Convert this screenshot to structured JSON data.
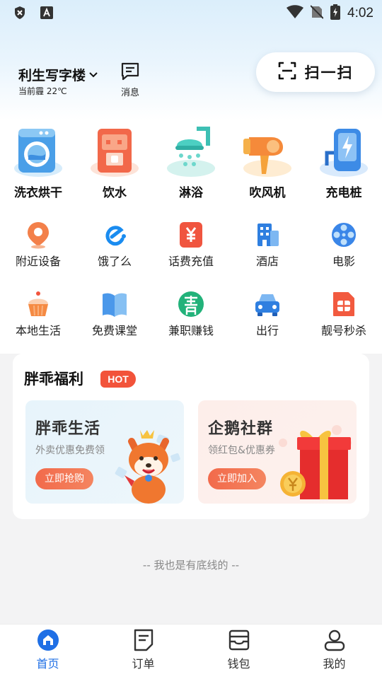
{
  "status_bar": {
    "time": "4:02",
    "icons": [
      "shield-x-icon",
      "a-icon",
      "wifi-icon",
      "no-sim-icon",
      "battery-charging-icon"
    ]
  },
  "header": {
    "location": "利生写字楼",
    "weather": "当前霾  22℃",
    "message_label": "消息",
    "scan_label": "扫一扫"
  },
  "services": [
    {
      "label": "洗衣烘干",
      "icon": "washing-machine-icon"
    },
    {
      "label": "饮水",
      "icon": "water-dispenser-icon"
    },
    {
      "label": "淋浴",
      "icon": "shower-icon"
    },
    {
      "label": "吹风机",
      "icon": "hair-dryer-icon"
    },
    {
      "label": "充电桩",
      "icon": "charging-pile-icon"
    }
  ],
  "grid_row1": [
    {
      "label": "附近设备",
      "icon": "location-pin-icon"
    },
    {
      "label": "饿了么",
      "icon": "eleme-icon"
    },
    {
      "label": "话费充值",
      "icon": "yen-icon"
    },
    {
      "label": "酒店",
      "icon": "hotel-icon"
    },
    {
      "label": "电影",
      "icon": "film-reel-icon"
    }
  ],
  "grid_row2": [
    {
      "label": "本地生活",
      "icon": "cupcake-icon"
    },
    {
      "label": "免费课堂",
      "icon": "book-icon"
    },
    {
      "label": "兼职赚钱",
      "icon": "qing-icon"
    },
    {
      "label": "出行",
      "icon": "car-icon"
    },
    {
      "label": "靓号秒杀",
      "icon": "sim-card-icon"
    }
  ],
  "welfare": {
    "title": "胖乖福利",
    "badge": "HOT",
    "cards": [
      {
        "title": "胖乖生活",
        "subtitle": "外卖优惠免费领",
        "button": "立即抢购"
      },
      {
        "title": "企鹅社群",
        "subtitle": "领红包&优惠券",
        "button": "立即加入"
      }
    ]
  },
  "bottom_note": "-- 我也是有底线的 --",
  "tabs": [
    {
      "label": "首页",
      "icon": "home-icon",
      "active": true
    },
    {
      "label": "订单",
      "icon": "order-icon",
      "active": false
    },
    {
      "label": "钱包",
      "icon": "wallet-icon",
      "active": false
    },
    {
      "label": "我的",
      "icon": "profile-icon",
      "active": false
    }
  ],
  "colors": {
    "accent": "#1f6fe5",
    "hot": "#f2533a",
    "promo_button": "#f26a4b"
  }
}
